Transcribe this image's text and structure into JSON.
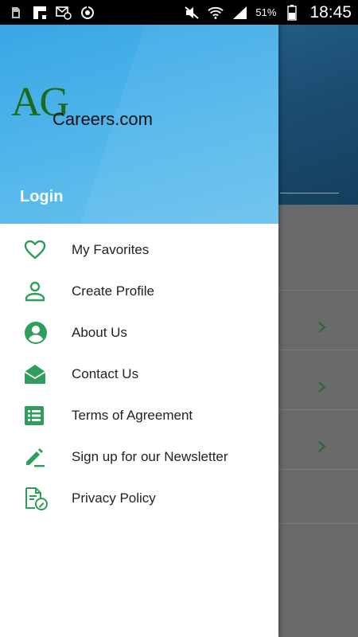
{
  "status_bar": {
    "battery_percent": "51%",
    "time": "18:45"
  },
  "drawer": {
    "logo": {
      "mark": "AG",
      "wordmark": "Careers.com"
    },
    "login_label": "Login",
    "menu": [
      {
        "label": "My Favorites",
        "icon": "heart-icon"
      },
      {
        "label": "Create Profile",
        "icon": "person-icon"
      },
      {
        "label": "About Us",
        "icon": "account-circle-icon"
      },
      {
        "label": "Contact Us",
        "icon": "open-envelope-icon"
      },
      {
        "label": "Terms of Agreement",
        "icon": "list-document-icon"
      },
      {
        "label": "Sign up for our Newsletter",
        "icon": "pencil-icon"
      },
      {
        "label": "Privacy Policy",
        "icon": "document-edit-icon"
      }
    ]
  },
  "colors": {
    "accent_green": "#2e9e5b",
    "drawer_header_blue": "#4eb4ea",
    "status_bar": "#000000"
  }
}
